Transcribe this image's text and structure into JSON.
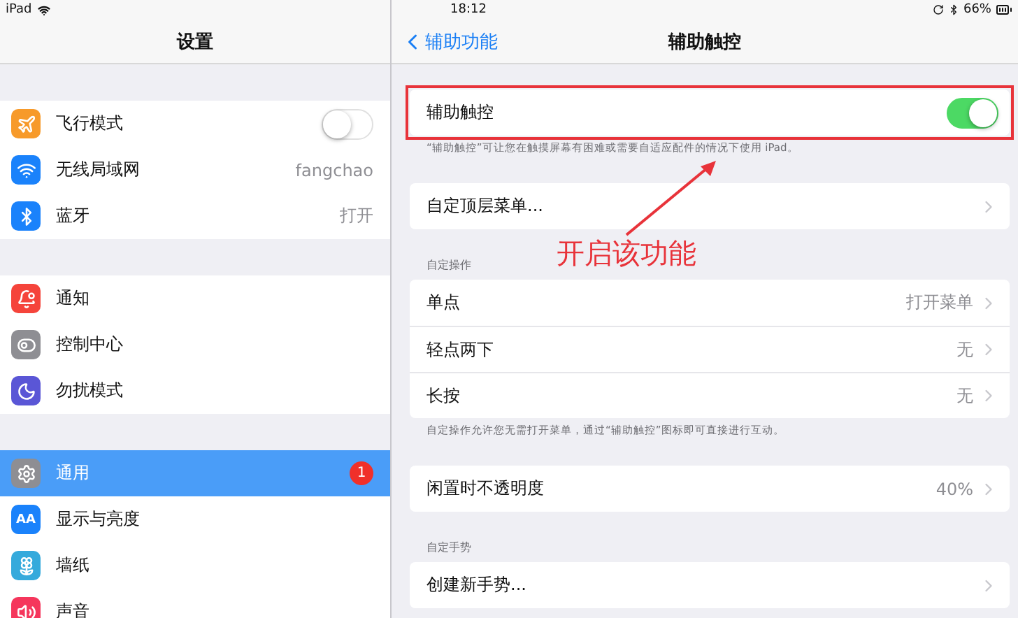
{
  "status_bar": {
    "device": "iPad",
    "time": "18:12",
    "battery": "66%"
  },
  "sidebar": {
    "title": "设置",
    "groups": [
      [
        {
          "label": "飞行模式",
          "kind": "toggle",
          "on": false,
          "selected": false,
          "color": "#f79a2a"
        },
        {
          "label": "无线局域网",
          "kind": "value",
          "value": "fangchao",
          "selected": false,
          "color": "#1a82fb"
        },
        {
          "label": "蓝牙",
          "kind": "value",
          "value": "打开",
          "selected": false,
          "color": "#1a82fb"
        }
      ],
      [
        {
          "label": "通知",
          "kind": "plain",
          "selected": false,
          "color": "#f5443b"
        },
        {
          "label": "控制中心",
          "kind": "plain",
          "selected": false,
          "color": "#8e8e93"
        },
        {
          "label": "勿扰模式",
          "kind": "plain",
          "selected": false,
          "color": "#5a56d6"
        }
      ],
      [
        {
          "label": "通用",
          "kind": "badge",
          "badge": "1",
          "selected": true,
          "color": "#8e8e93"
        },
        {
          "label": "显示与亮度",
          "kind": "plain",
          "icon_text": "AA",
          "selected": false,
          "color": "#1a82fb"
        },
        {
          "label": "墙纸",
          "kind": "plain",
          "selected": false,
          "color": "#35aadc"
        },
        {
          "label": "声音",
          "kind": "plain",
          "selected": false,
          "color": "#f5365c"
        }
      ]
    ]
  },
  "nav": {
    "back": "辅助功能",
    "title": "辅助触控"
  },
  "sections": [
    {
      "rows": [
        {
          "kind": "toggle",
          "label": "辅助触控",
          "on": true,
          "highlighted": true
        }
      ],
      "footer": "“辅助触控”可让您在触摸屏幕有困难或需要自适应配件的情况下使用 iPad。"
    },
    {
      "rows": [
        {
          "kind": "link",
          "label": "自定顶层菜单..."
        }
      ]
    },
    {
      "header": "自定操作",
      "rows": [
        {
          "kind": "link",
          "label": "单点",
          "value": "打开菜单"
        },
        {
          "kind": "link",
          "label": "轻点两下",
          "value": "无"
        },
        {
          "kind": "link",
          "label": "长按",
          "value": "无"
        }
      ],
      "footer": "自定操作允许您无需打开菜单，通过“辅助触控”图标即可直接进行互动。"
    },
    {
      "rows": [
        {
          "kind": "link",
          "label": "闲置时不透明度",
          "value": "40%"
        }
      ]
    },
    {
      "header": "自定手势",
      "rows": [
        {
          "kind": "link",
          "label": "创建新手势..."
        }
      ]
    }
  ],
  "annotation": {
    "text": "开启该功能"
  }
}
